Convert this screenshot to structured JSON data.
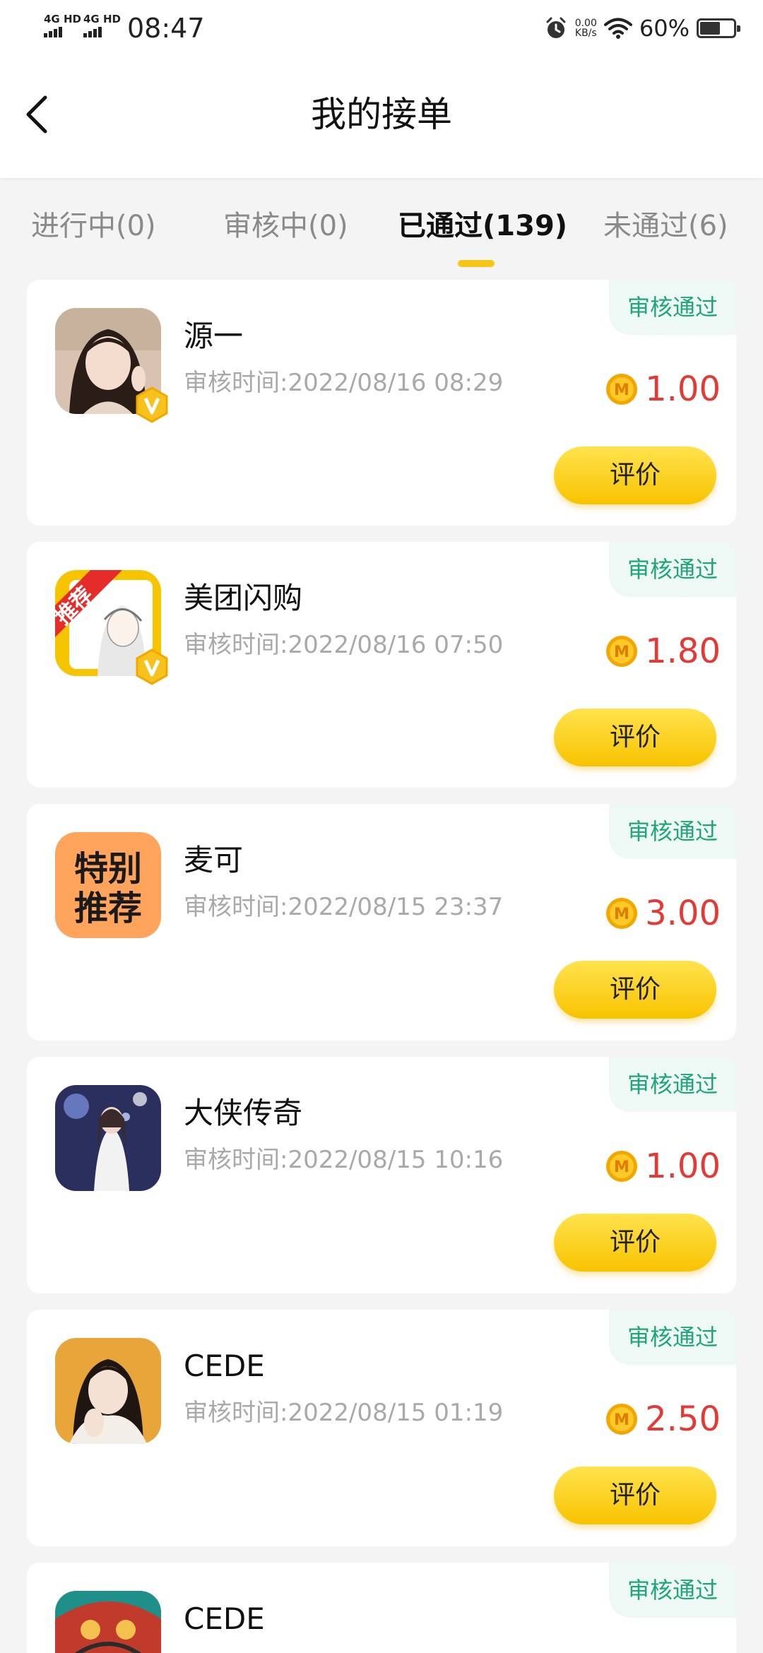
{
  "status_bar": {
    "signal_1": "4G HD",
    "signal_2": "4G HD",
    "time": "08:47",
    "net_speed_value": "0.00",
    "net_speed_unit": "KB/s",
    "battery_text": "60%",
    "battery_level": 0.6,
    "icons": [
      "alarm-icon",
      "wifi-icon",
      "battery-icon"
    ]
  },
  "header": {
    "back_icon": "chevron-left-icon",
    "title": "我的接单"
  },
  "tabs": [
    {
      "label": "进行中(0)",
      "active": false
    },
    {
      "label": "审核中(0)",
      "active": false
    },
    {
      "label": "已通过(139)",
      "active": true
    },
    {
      "label": "未通过(6)",
      "active": false
    }
  ],
  "colors": {
    "accent": "#f5c518",
    "status_green": "#1fa57a",
    "amount_red": "#e53935"
  },
  "orders": [
    {
      "name": "源一",
      "time": "审核时间:2022/08/16 08:29",
      "amount": "1.00",
      "status": "审核通过",
      "action": "评价",
      "avatar": "portrait-girl",
      "vip": true
    },
    {
      "name": "美团闪购",
      "time": "审核时间:2022/08/16 07:50",
      "amount": "1.80",
      "status": "审核通过",
      "action": "评价",
      "avatar": "recommend-sketch",
      "avatar_text": "推荐",
      "vip": true
    },
    {
      "name": "麦可",
      "time": "审核时间:2022/08/15 23:37",
      "amount": "3.00",
      "status": "审核通过",
      "action": "评价",
      "avatar": "special-recommend",
      "avatar_text_1": "特别",
      "avatar_text_2": "推荐",
      "vip": false
    },
    {
      "name": "大侠传奇",
      "time": "审核时间:2022/08/15 10:16",
      "amount": "1.00",
      "status": "审核通过",
      "action": "评价",
      "avatar": "stage-performer",
      "vip": false
    },
    {
      "name": "CEDE",
      "time": "审核时间:2022/08/15 01:19",
      "amount": "2.50",
      "status": "审核通过",
      "action": "评价",
      "avatar": "portrait-sweater",
      "vip": false
    },
    {
      "name": "CEDE",
      "time": "",
      "amount": "",
      "status": "审核通过",
      "action": "",
      "avatar": "game-art",
      "vip": false
    }
  ]
}
